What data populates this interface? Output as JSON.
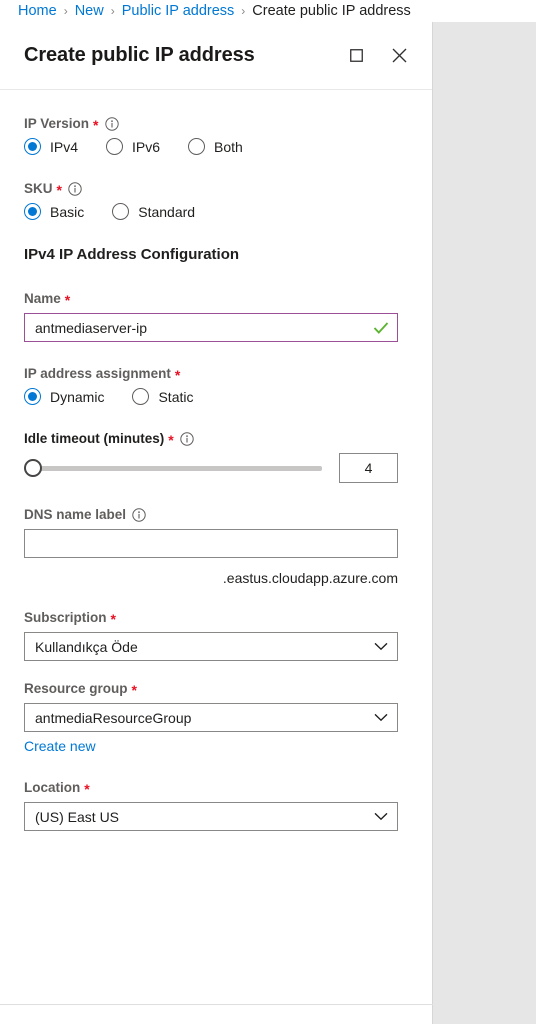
{
  "breadcrumb": {
    "items": [
      {
        "label": "Home",
        "is_link": true
      },
      {
        "label": "New",
        "is_link": true
      },
      {
        "label": "Public IP address",
        "is_link": true
      },
      {
        "label": "Create public IP address",
        "is_link": false
      }
    ],
    "separator": "›"
  },
  "blade": {
    "title": "Create public IP address",
    "maximize_icon": "maximize-icon",
    "close_icon": "close-icon"
  },
  "form": {
    "ip_version": {
      "label": "IP Version",
      "required": "*",
      "info_icon": "info-icon",
      "options": [
        {
          "label": "IPv4",
          "checked": true
        },
        {
          "label": "IPv6",
          "checked": false
        },
        {
          "label": "Both",
          "checked": false
        }
      ]
    },
    "sku": {
      "label": "SKU",
      "required": "*",
      "info_icon": "info-icon",
      "options": [
        {
          "label": "Basic",
          "checked": true
        },
        {
          "label": "Standard",
          "checked": false
        }
      ]
    },
    "section_heading": "IPv4 IP Address Configuration",
    "name": {
      "label": "Name",
      "required": "*",
      "value": "antmediaserver-ip",
      "placeholder": "",
      "valid_icon": "checkmark-icon",
      "valid": true
    },
    "ip_assignment": {
      "label": "IP address assignment",
      "required": "*",
      "options": [
        {
          "label": "Dynamic",
          "checked": true
        },
        {
          "label": "Static",
          "checked": false
        }
      ]
    },
    "idle_timeout": {
      "label": "Idle timeout (minutes)",
      "required": "*",
      "info_icon": "info-icon",
      "value": "4",
      "min": "4",
      "max": "30",
      "percent": 0
    },
    "dns_name_label": {
      "label": "DNS name label",
      "info_icon": "info-icon",
      "value": "",
      "placeholder": "",
      "suffix": ".eastus.cloudapp.azure.com"
    },
    "subscription": {
      "label": "Subscription",
      "required": "*",
      "value": "Kullandıkça Öde",
      "chevron_icon": "chevron-down-icon"
    },
    "resource_group": {
      "label": "Resource group",
      "required": "*",
      "value": "antmediaResourceGroup",
      "chevron_icon": "chevron-down-icon",
      "create_new_link": "Create new"
    },
    "location": {
      "label": "Location",
      "required": "*",
      "value": "(US) East US",
      "chevron_icon": "chevron-down-icon"
    }
  },
  "colors": {
    "accent": "#0078d4",
    "required": "#e81123",
    "valid_border": "#9b4f96",
    "valid_check": "#5cb531",
    "label": "#605e5c",
    "panel_bg": "#ffffff",
    "page_bg": "#e6e6e6"
  }
}
